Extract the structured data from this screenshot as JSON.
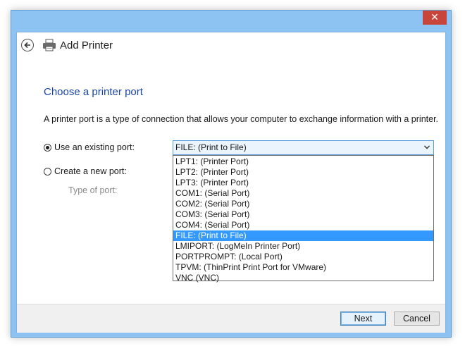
{
  "window": {
    "close_glyph": "✕"
  },
  "header": {
    "title": "Add Printer",
    "back_icon": "back-arrow-icon",
    "printer_icon": "printer-icon"
  },
  "content": {
    "heading": "Choose a printer port",
    "description": "A printer port is a type of connection that allows your computer to exchange information with a printer.",
    "use_existing_label": "Use an existing port:",
    "create_new_label": "Create a new port:",
    "type_of_port_label": "Type of port:",
    "selected_port": "FILE: (Print to File)",
    "ports": [
      "LPT1: (Printer Port)",
      "LPT2: (Printer Port)",
      "LPT3: (Printer Port)",
      "COM1: (Serial Port)",
      "COM2: (Serial Port)",
      "COM3: (Serial Port)",
      "COM4: (Serial Port)",
      "FILE: (Print to File)",
      "LMIPORT: (LogMeIn Printer Port)",
      "PORTPROMPT: (Local Port)",
      "TPVM: (ThinPrint Print Port for VMware)",
      "VNC (VNC)"
    ],
    "highlighted_index": 7
  },
  "footer": {
    "next_label": "Next",
    "cancel_label": "Cancel"
  },
  "colors": {
    "frame": "#8cc3f2",
    "close": "#c7453a",
    "heading": "#1a46a6",
    "selection": "#3399ff"
  }
}
